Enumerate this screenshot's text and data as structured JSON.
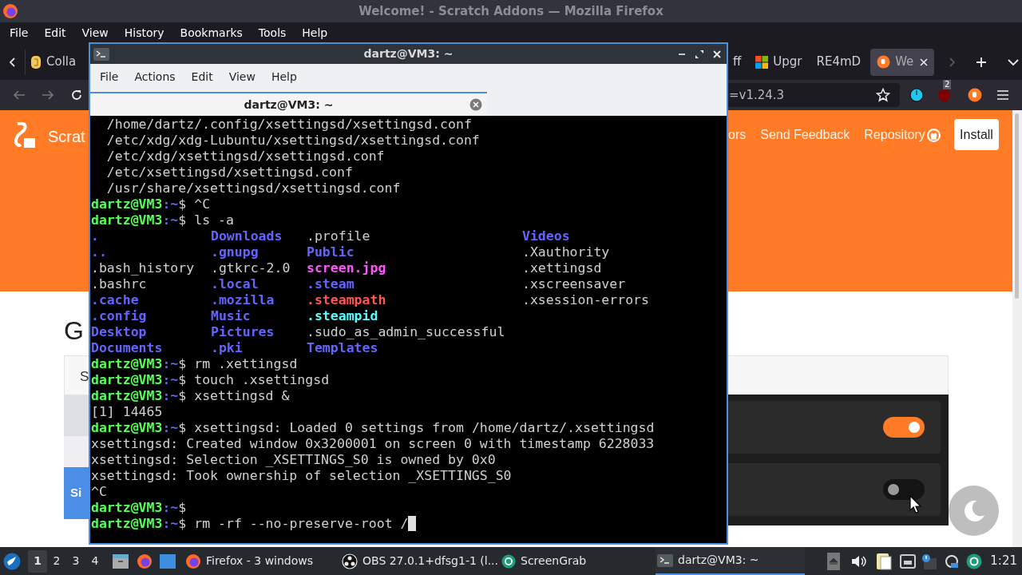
{
  "firefox": {
    "title": "Welcome! - Scratch Addons — Mozilla Firefox",
    "menu": [
      "File",
      "Edit",
      "View",
      "History",
      "Bookmarks",
      "Tools",
      "Help"
    ],
    "tabs": [
      {
        "title": "Colla",
        "selected": false
      },
      {
        "title": "ff",
        "selected": false
      },
      {
        "title": "Upgr",
        "selected": false
      },
      {
        "title": "RE4mD",
        "selected": false
      },
      {
        "title": "We",
        "selected": true
      }
    ],
    "url": "=v1.24.3",
    "extension_badge": "2"
  },
  "page": {
    "brand": "Scrat",
    "nav": [
      "ors",
      "Send Feedback",
      "Repository"
    ],
    "install_button": "Install",
    "heading": "G",
    "card_tab": "S",
    "sign_button": "Si",
    "toggles": [
      {
        "on": true
      },
      {
        "on": false
      }
    ]
  },
  "terminal": {
    "title": "dartz@VM3: ~",
    "menu": [
      "File",
      "Actions",
      "Edit",
      "View",
      "Help"
    ],
    "tab": "dartz@VM3: ~",
    "lines": [
      {
        "kind": "text",
        "text": "  /home/dartz/.config/xsettingsd/xsettingsd.conf"
      },
      {
        "kind": "text",
        "text": "  /etc/xdg/xdg-Lubuntu/xsettingsd/xsettingsd.conf"
      },
      {
        "kind": "text",
        "text": "  /etc/xdg/xsettingsd/xsettingsd.conf"
      },
      {
        "kind": "text",
        "text": "  /etc/xsettingsd/xsettingsd.conf"
      },
      {
        "kind": "text",
        "text": "  /usr/share/xsettingsd/xsettingsd.conf"
      },
      {
        "kind": "prompt",
        "user": "dartz@VM3",
        "path": ":~",
        "symbol": "$",
        "command": "^C"
      },
      {
        "kind": "prompt",
        "user": "dartz@VM3",
        "path": ":~",
        "symbol": "$",
        "command": "ls -a"
      },
      {
        "kind": "ls",
        "cells": [
          {
            "text": ".",
            "kind": "dir"
          },
          {
            "text": "Downloads",
            "kind": "dir"
          },
          {
            "text": ".profile",
            "kind": "file"
          },
          {
            "text": "Videos",
            "kind": "dir"
          }
        ]
      },
      {
        "kind": "ls",
        "cells": [
          {
            "text": "..",
            "kind": "dir"
          },
          {
            "text": ".gnupg",
            "kind": "dir"
          },
          {
            "text": "Public",
            "kind": "dir"
          },
          {
            "text": ".Xauthority",
            "kind": "file"
          }
        ]
      },
      {
        "kind": "ls",
        "cells": [
          {
            "text": ".bash_history",
            "kind": "file"
          },
          {
            "text": ".gtkrc-2.0",
            "kind": "file"
          },
          {
            "text": "screen.jpg",
            "kind": "image"
          },
          {
            "text": ".xettingsd",
            "kind": "file"
          }
        ]
      },
      {
        "kind": "ls",
        "cells": [
          {
            "text": ".bashrc",
            "kind": "file"
          },
          {
            "text": ".local",
            "kind": "dir"
          },
          {
            "text": ".steam",
            "kind": "dir"
          },
          {
            "text": ".xscreensaver",
            "kind": "file"
          }
        ]
      },
      {
        "kind": "ls",
        "cells": [
          {
            "text": ".cache",
            "kind": "dir"
          },
          {
            "text": ".mozilla",
            "kind": "dir"
          },
          {
            "text": ".steampath",
            "kind": "broken_link"
          },
          {
            "text": ".xsession-errors",
            "kind": "file"
          }
        ]
      },
      {
        "kind": "ls",
        "cells": [
          {
            "text": ".config",
            "kind": "dir"
          },
          {
            "text": "Music",
            "kind": "dir"
          },
          {
            "text": ".steampid",
            "kind": "link"
          }
        ]
      },
      {
        "kind": "ls",
        "cells": [
          {
            "text": "Desktop",
            "kind": "dir"
          },
          {
            "text": "Pictures",
            "kind": "dir"
          },
          {
            "text": ".sudo_as_admin_successful",
            "kind": "file"
          }
        ]
      },
      {
        "kind": "ls",
        "cells": [
          {
            "text": "Documents",
            "kind": "dir"
          },
          {
            "text": ".pki",
            "kind": "dir"
          },
          {
            "text": "Templates",
            "kind": "dir"
          }
        ]
      },
      {
        "kind": "prompt",
        "user": "dartz@VM3",
        "path": ":~",
        "symbol": "$",
        "command": "rm .xettingsd"
      },
      {
        "kind": "prompt",
        "user": "dartz@VM3",
        "path": ":~",
        "symbol": "$",
        "command": "touch .xsettingsd"
      },
      {
        "kind": "prompt",
        "user": "dartz@VM3",
        "path": ":~",
        "symbol": "$",
        "command": "xsettingsd &"
      },
      {
        "kind": "text",
        "text": "[1] 14465"
      },
      {
        "kind": "prompt",
        "user": "dartz@VM3",
        "path": ":~",
        "symbol": "$",
        "command": "xsettingsd: Loaded 0 settings from /home/dartz/.xsettingsd"
      },
      {
        "kind": "text",
        "text": "xsettingsd: Created window 0x3200001 on screen 0 with timestamp 6228033"
      },
      {
        "kind": "text",
        "text": "xsettingsd: Selection _XSETTINGS_S0 is owned by 0x0"
      },
      {
        "kind": "text",
        "text": "xsettingsd: Took ownership of selection _XSETTINGS_S0"
      },
      {
        "kind": "text",
        "text": "^C"
      },
      {
        "kind": "prompt",
        "user": "dartz@VM3",
        "path": ":~",
        "symbol": "$"
      },
      {
        "kind": "prompt",
        "user": "dartz@VM3",
        "path": ":~",
        "symbol": "$",
        "command": "rm -rf --no-preserve-root /",
        "cursor": true
      }
    ]
  },
  "taskbar": {
    "workspaces": [
      {
        "label": "1",
        "selected": true
      },
      {
        "label": "2",
        "selected": false
      },
      {
        "label": "3",
        "selected": false
      },
      {
        "label": "4",
        "selected": false
      }
    ],
    "tasks": [
      {
        "label": "Firefox - 3 windows",
        "selected": false
      },
      {
        "label": "OBS 27.0.1+dfsg1-1 (l...",
        "selected": false
      },
      {
        "label": "ScreenGrab",
        "selected": false
      },
      {
        "label": "dartz@VM3: ~",
        "selected": true
      }
    ],
    "clock": "1:21"
  }
}
